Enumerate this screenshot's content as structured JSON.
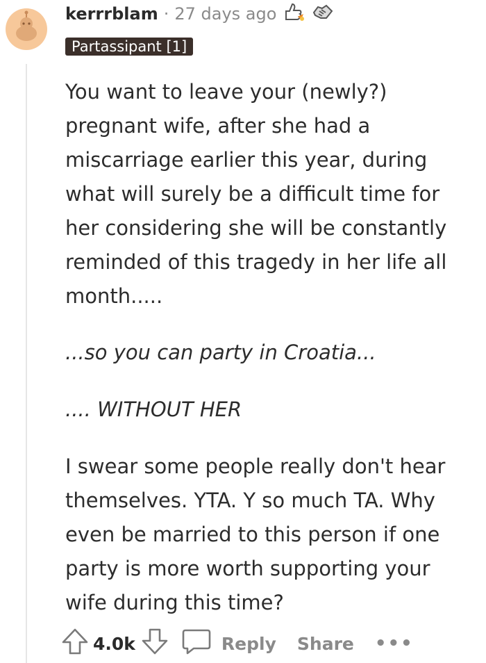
{
  "comment": {
    "username": "kerrrblam",
    "separator": "·",
    "time_ago": "27 days ago",
    "awards": [
      "thumbs-up-rocket-award",
      "handshake-award"
    ],
    "flair": "Partassipant [1]",
    "paragraphs": [
      "You want to leave your (newly?) pregnant wife, after she had a miscarriage earlier this year, during what will surely be a difficult time for her considering she will be constantly reminded of this tragedy in her life all month.....",
      "...so you can party in Croatia...",
      ".... WITHOUT HER",
      "I swear some people really don't hear themselves. YTA. Y so much TA. Why even be married to this person if one party is more worth supporting your wife during this time?"
    ]
  },
  "actions": {
    "score": "4.0k",
    "reply_label": "Reply",
    "share_label": "Share",
    "more_label": "•••"
  },
  "icons": {
    "upvote": "upvote-arrow-icon",
    "downvote": "downvote-arrow-icon",
    "reply": "speech-bubble-icon"
  },
  "colors": {
    "flair_bg": "#3b2f2a",
    "muted": "#8a8a8a",
    "avatar_bg": "#f7c89a"
  }
}
